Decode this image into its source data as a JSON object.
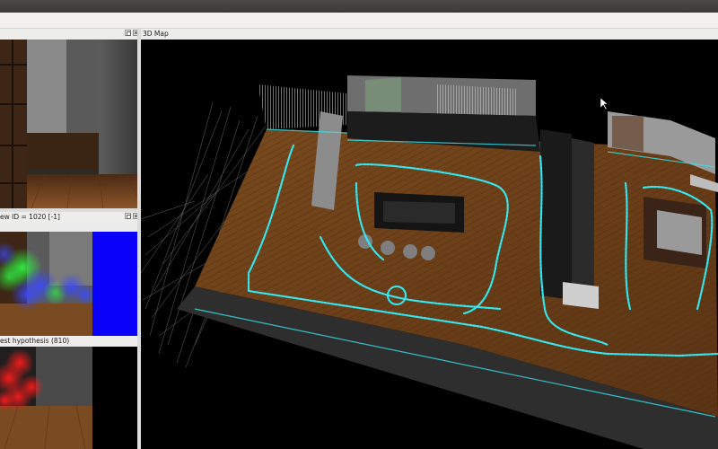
{
  "window": {
    "colors": {
      "titlebar": "#3f3e3a",
      "panel_bg": "#ededec",
      "map_bg": "#000000",
      "trajectory": "#33e6ef",
      "blue_panel": "#0800f8"
    }
  },
  "panels": {
    "camera": {
      "title": ""
    },
    "loop_closure": {
      "title": "ew ID = 1020 [-1]"
    },
    "best_hypothesis": {
      "title": "est hypothesis (810)"
    },
    "map3d": {
      "title": "3D Map"
    }
  },
  "icons": [
    "float-icon",
    "close-icon",
    "mouse-cursor-icon"
  ]
}
